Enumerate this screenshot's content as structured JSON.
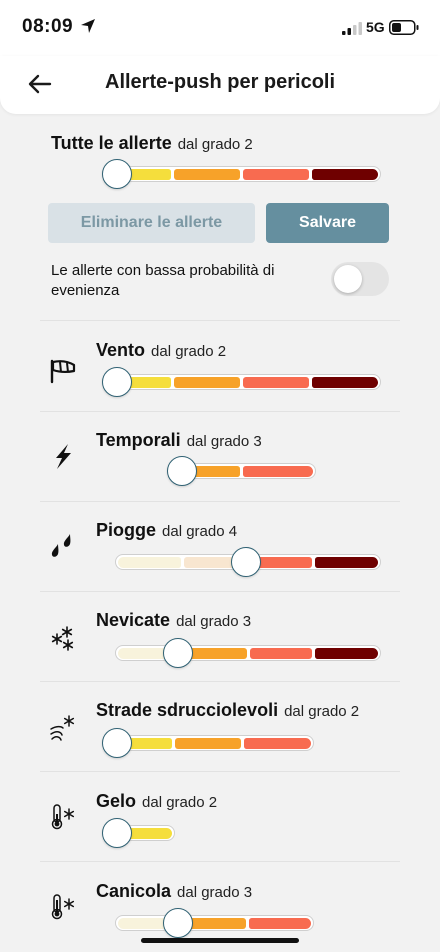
{
  "status": {
    "time": "08:09",
    "network": "5G"
  },
  "header": {
    "title": "Allerte-push per pericoli"
  },
  "all": {
    "label": "Tutte le allerte",
    "level": "dal grado 2"
  },
  "buttons": {
    "clear": "Eliminare le allerte",
    "save": "Salvare"
  },
  "lowprob": {
    "label": "Le allerte con bassa probabilità di evenienza",
    "enabled": false
  },
  "hazards": [
    {
      "label": "Vento",
      "level": "dal grado 2",
      "icon": "windsock-icon"
    },
    {
      "label": "Temporali",
      "level": "dal grado 3",
      "icon": "lightning-icon"
    },
    {
      "label": "Piogge",
      "level": "dal grado 4",
      "icon": "raindrops-icon"
    },
    {
      "label": "Nevicate",
      "level": "dal grado 3",
      "icon": "snowflakes-icon"
    },
    {
      "label": "Strade sdrucciolevoli",
      "level": "dal grado 2",
      "icon": "slippery-road-icon"
    },
    {
      "label": "Gelo",
      "level": "dal grado 2",
      "icon": "frost-thermometer-icon"
    },
    {
      "label": "Canicola",
      "level": "dal grado 3",
      "icon": "heat-thermometer-icon"
    }
  ],
  "colors": {
    "accent": "#2f6173",
    "grade2": "#f5de3c",
    "grade3": "#f7a229",
    "grade4": "#f86b50",
    "grade5": "#6f0000",
    "inactive2": "#f8f3dc",
    "inactive3": "#f8e6d0",
    "save": "#658f9f",
    "clear": "#d9e1e6"
  }
}
